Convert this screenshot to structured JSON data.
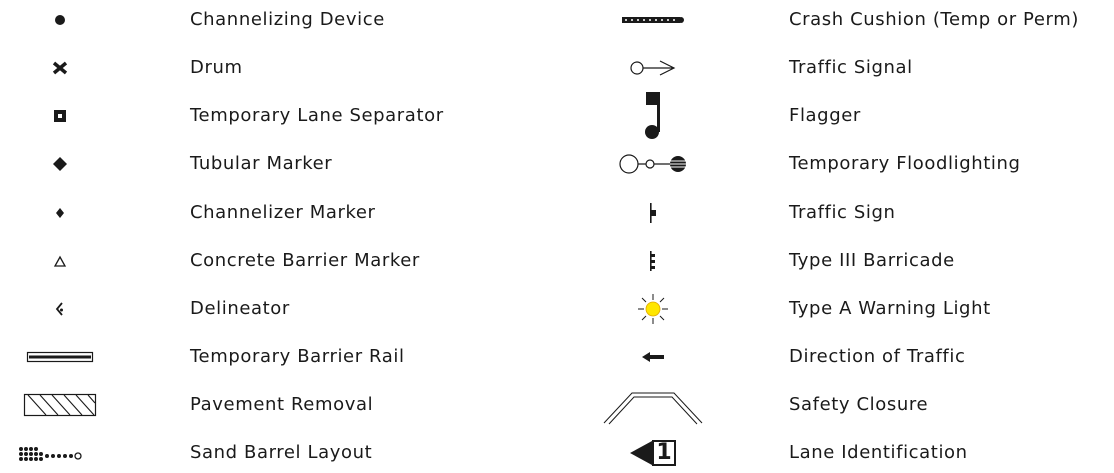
{
  "legend": {
    "left": [
      {
        "label": "Channelizing Device",
        "icon": "channelizing-device-icon"
      },
      {
        "label": "Drum",
        "icon": "drum-icon"
      },
      {
        "label": "Temporary Lane Separator",
        "icon": "temporary-lane-separator-icon"
      },
      {
        "label": "Tubular Marker",
        "icon": "tubular-marker-icon"
      },
      {
        "label": "Channelizer Marker",
        "icon": "channelizer-marker-icon"
      },
      {
        "label": "Concrete Barrier Marker",
        "icon": "concrete-barrier-marker-icon"
      },
      {
        "label": "Delineator",
        "icon": "delineator-icon"
      },
      {
        "label": "Temporary Barrier Rail",
        "icon": "temporary-barrier-rail-icon"
      },
      {
        "label": "Pavement Removal",
        "icon": "pavement-removal-icon"
      },
      {
        "label": "Sand Barrel Layout",
        "icon": "sand-barrel-layout-icon"
      }
    ],
    "right": [
      {
        "label": "Crash Cushion (Temp or Perm)",
        "icon": "crash-cushion-icon"
      },
      {
        "label": "Traffic Signal",
        "icon": "traffic-signal-icon"
      },
      {
        "label": "Flagger",
        "icon": "flagger-icon"
      },
      {
        "label": "Temporary Floodlighting",
        "icon": "temporary-floodlighting-icon"
      },
      {
        "label": "Traffic Sign",
        "icon": "traffic-sign-icon"
      },
      {
        "label": "Type III Barricade",
        "icon": "type-iii-barricade-icon"
      },
      {
        "label": "Type A Warning Light",
        "icon": "type-a-warning-light-icon"
      },
      {
        "label": "Direction of Traffic",
        "icon": "direction-of-traffic-icon"
      },
      {
        "label": "Safety Closure",
        "icon": "safety-closure-icon"
      },
      {
        "label": "Lane Identification",
        "icon": "lane-identification-icon",
        "text": "1"
      }
    ]
  },
  "colors": {
    "ink": "#1a1a1a",
    "warning_light": "#ffe600",
    "warning_light_edge": "#e0a800"
  }
}
